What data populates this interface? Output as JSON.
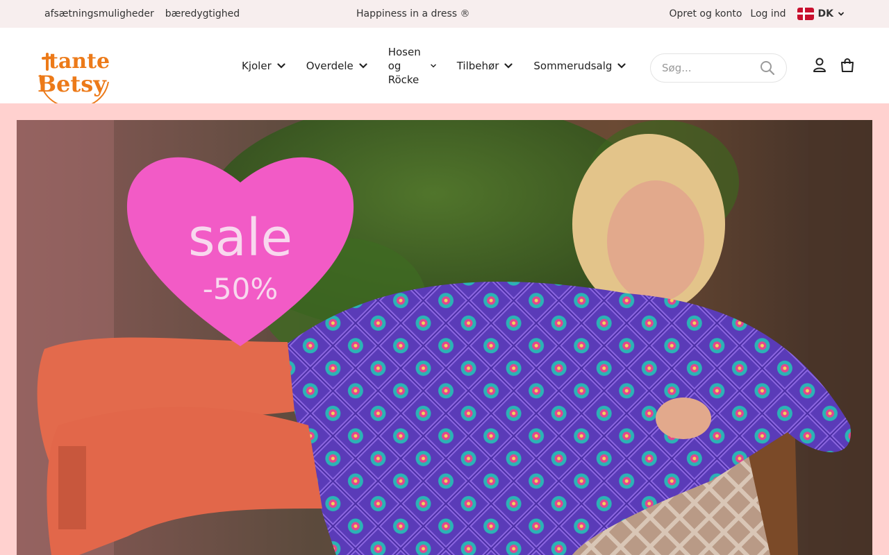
{
  "topbar": {
    "links_left": [
      "afsætningsmuligheder",
      "bæredygtighed"
    ],
    "tagline": "Happiness in a dress ®",
    "create_account": "Opret og konto",
    "login": "Log ind",
    "country": "DK"
  },
  "brand": {
    "logo_line1": "tante",
    "logo_line2": "Betsy",
    "color": "#ec7a19"
  },
  "nav": {
    "items": [
      {
        "label": "Kjoler"
      },
      {
        "label": "Overdele"
      },
      {
        "label_lines": [
          "Hosen",
          "og",
          "Röcke"
        ]
      },
      {
        "label": "Tilbehør"
      },
      {
        "label": "Sommerudsalg"
      }
    ]
  },
  "search": {
    "placeholder": "Søg..."
  },
  "hero": {
    "badge_title": "sale",
    "badge_discount": "-50%",
    "badge_color": "#f25bc6",
    "background_color": "#ffd1cf"
  },
  "icons": {
    "search": "search-icon",
    "user": "user-icon",
    "bag": "shopping-bag-icon",
    "chevron": "chevron-down-icon",
    "flag": "flag-dk-icon"
  }
}
